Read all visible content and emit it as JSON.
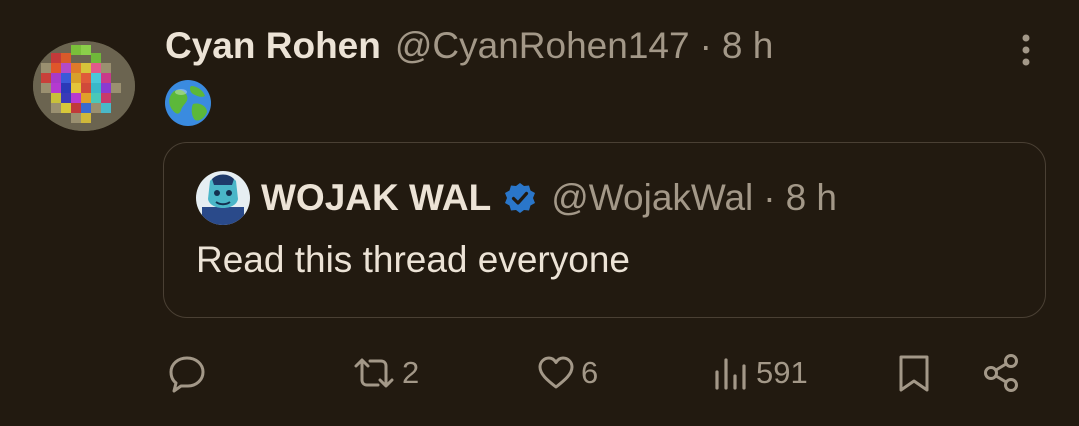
{
  "post": {
    "author_name": "Cyan Rohen",
    "author_handle": "@CyanRohen147",
    "separator": "·",
    "time": "8 h",
    "body_emoji": "globe-emoji"
  },
  "quoted_post": {
    "author_name": "WOJAK WAL",
    "verified": true,
    "author_handle": "@WojakWal",
    "separator": "·",
    "time": "8 h",
    "text": "Read this thread everyone"
  },
  "actions": {
    "reply_icon": "reply-icon",
    "repost_icon": "repost-icon",
    "repost_count": "2",
    "like_icon": "heart-icon",
    "like_count": "6",
    "views_icon": "bar-chart-icon",
    "views_count": "591",
    "bookmark_icon": "bookmark-icon",
    "share_icon": "share-icon"
  },
  "colors": {
    "background": "#221a10",
    "primary_text": "#ece3d6",
    "secondary_text": "#a39888",
    "border": "#4a4034",
    "verified_badge": "#2a76c9"
  }
}
